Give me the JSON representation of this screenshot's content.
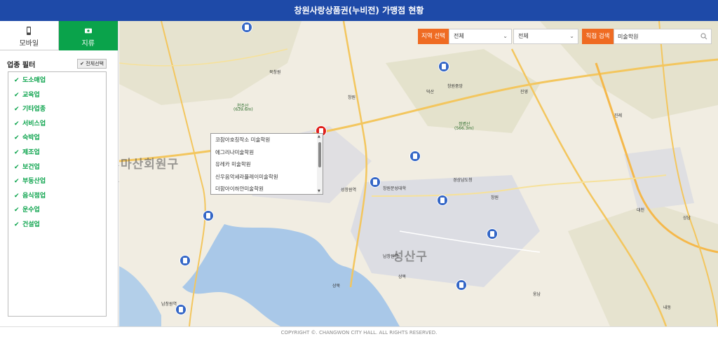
{
  "header": {
    "title": "창원사랑상품권(누비전) 가맹점 현황"
  },
  "tabs": [
    {
      "label": "모바일",
      "icon": "phone-icon",
      "active": false
    },
    {
      "label": "지류",
      "icon": "ticket-icon",
      "active": true
    }
  ],
  "filter": {
    "title": "업종 필터",
    "select_all_label": "전체선택",
    "items": [
      "도소매업",
      "교육업",
      "기타업종",
      "서비스업",
      "숙박업",
      "제조업",
      "보건업",
      "부동산업",
      "음식점업",
      "운수업",
      "건설업"
    ]
  },
  "search": {
    "region_label": "지역 선택",
    "region1_value": "전체",
    "region2_value": "전체",
    "direct_label": "직접 검색",
    "query": "미술학원"
  },
  "suggestions": [
    "코참아호칭작소 미술학원",
    "에그리나미술학원",
    "유레카 미술학원",
    "신우음악세라플레이미술학원",
    "더함아이하얀미술학원"
  ],
  "map": {
    "districts": [
      "마산회원구",
      "성산구"
    ],
    "places": [
      "북창원",
      "천주산",
      "(639.6m)",
      "창원",
      "덕산",
      "창원중앙",
      "정병산",
      "(566.3m)",
      "경상남도청",
      "성창원역",
      "창원문성대학",
      "남창원역",
      "상북",
      "상복",
      "웅남",
      "남창원역",
      "진영",
      "진례",
      "내동",
      "대천",
      "창원",
      "상남"
    ],
    "colors": {
      "marker_blue": "#3466c6",
      "marker_red": "#e0201c",
      "accent_orange": "#ef6b22",
      "accent_green": "#0aa34b",
      "header_blue": "#1e4aa8"
    }
  },
  "footer": {
    "text": "COPYRIGHT ©. CHANGWON CITY HALL. ALL RIGHTS RESERVED."
  }
}
